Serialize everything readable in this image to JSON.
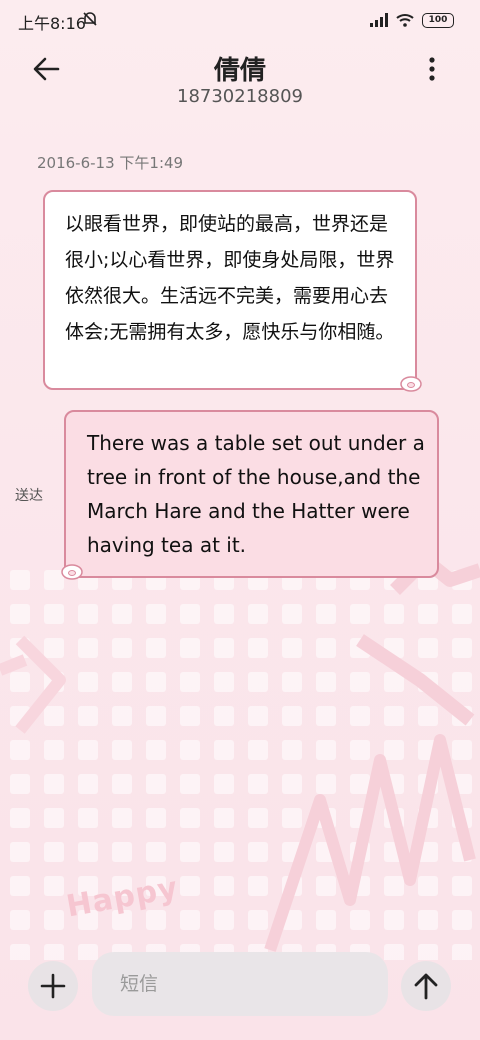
{
  "status_bar": {
    "time": "上午8:16",
    "battery": "100"
  },
  "header": {
    "title": "倩倩",
    "phone": "18730218809"
  },
  "conversation": {
    "timestamp": "2016-6-13 下午1:49",
    "received_message": "以眼看世界，即使站的最高，世界还是很小;以心看世界，即使身处局限，世界依然很大。生活远不完美，需要用心去体会;无需拥有太多，愿快乐与你相随。",
    "sent_message": "There was a table set out under a tree in front of the house,and the March Hare and the Hatter were having tea at it.",
    "sent_status": "送达"
  },
  "background": {
    "decor_text": "Happy"
  },
  "composer": {
    "placeholder": "短信",
    "value": ""
  },
  "icons": {
    "back": "arrow-left-icon",
    "more": "more-vertical-icon",
    "add": "plus-icon",
    "send": "arrow-up-icon",
    "signal": "signal-icon",
    "wifi": "wifi-icon",
    "dnd": "do-not-disturb-icon"
  },
  "colors": {
    "bubble_border": "#d98a9d",
    "sent_bubble": "#fbdde4",
    "background": "#fcecef"
  }
}
